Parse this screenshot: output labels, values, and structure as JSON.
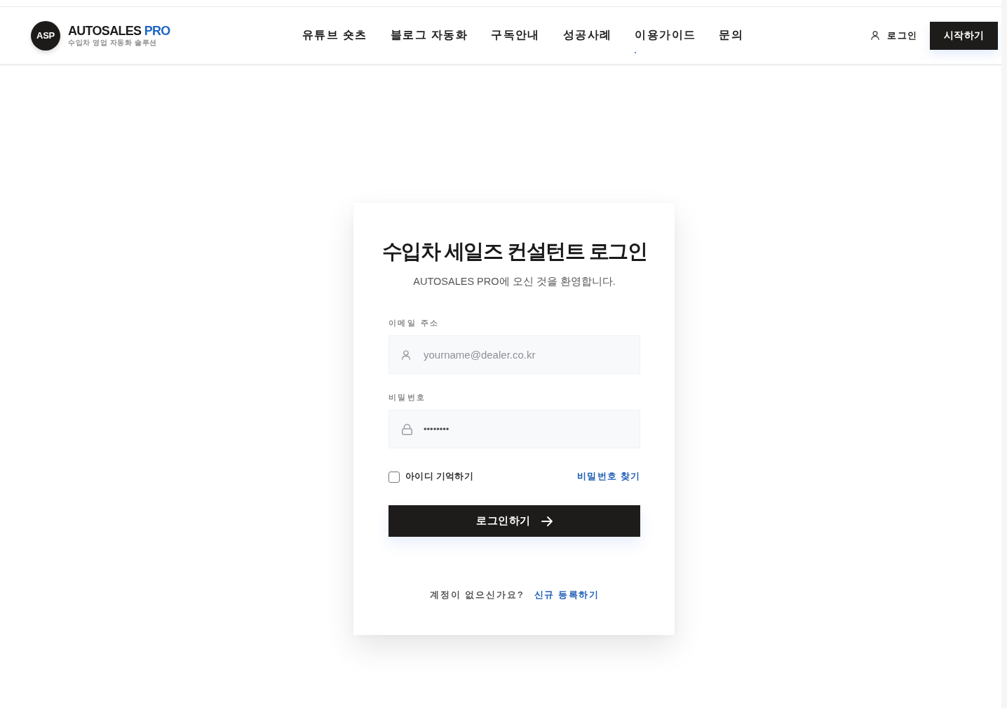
{
  "header": {
    "logo": {
      "mark": "ASP",
      "name": "AUTOSALES",
      "name_accent": "PRO",
      "tagline": "수입차 영업 자동화 솔루션"
    },
    "nav": [
      {
        "label": "유튜브 숏츠",
        "selected": false
      },
      {
        "label": "블로그 자동화",
        "selected": false
      },
      {
        "label": "구독안내",
        "selected": false
      },
      {
        "label": "성공사례",
        "selected": false
      },
      {
        "label": "이용가이드",
        "selected": true
      },
      {
        "label": "문의",
        "selected": false
      }
    ],
    "login_link": "로그인",
    "start_button": "시작하기"
  },
  "login_card": {
    "title": "수입차 세일즈 컨설턴트 로그인",
    "subtitle": "AUTOSALES PRO에 오신 것을 환영합니다.",
    "fields": [
      {
        "kind": "email",
        "label": "이메일 주소",
        "placeholder": "yourname@dealer.co.kr"
      },
      {
        "kind": "password",
        "label": "비밀번호",
        "value": "••••••••"
      }
    ],
    "remember": {
      "label": "아이디 기억하기",
      "checked": false
    },
    "forgot_link": "비밀번호 찾기",
    "submit_button": "로그인하기",
    "signup": {
      "prompt": "계정이 없으신가요?",
      "link": "신규 등록하기"
    }
  }
}
